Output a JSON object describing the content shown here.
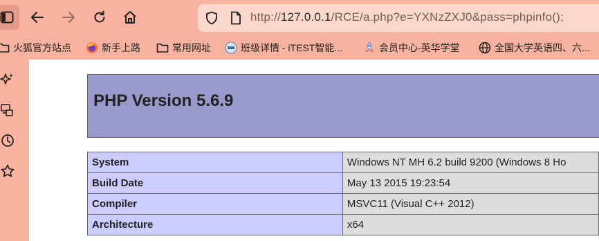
{
  "toolbar": {
    "url_prefix": "http://",
    "url_host": "127.0.0.1",
    "url_rest": "/RCE/a.php?e=YXNzZXJ0&pass=phpinfo();"
  },
  "bookmarks": [
    {
      "label": "火狐官方站点",
      "icon": "folder-icon"
    },
    {
      "label": "新手上路",
      "icon": "firefox-icon"
    },
    {
      "label": "常用网址",
      "icon": "folder-icon"
    },
    {
      "label": "班级详情 - iTEST智能...",
      "icon": "itest-icon"
    },
    {
      "label": "会员中心-英华学堂",
      "icon": "rocket-icon"
    },
    {
      "label": "全国大学英语四、六...",
      "icon": "globe-icon"
    }
  ],
  "page": {
    "title": "PHP Version 5.6.9",
    "rows": [
      {
        "key": "System",
        "value": "Windows NT MH 6.2 build 9200 (Windows 8 Ho"
      },
      {
        "key": "Build Date",
        "value": "May 13 2015 19:23:54"
      },
      {
        "key": "Compiler",
        "value": "MSVC11 (Visual C++ 2012)"
      },
      {
        "key": "Architecture",
        "value": "x64"
      }
    ]
  },
  "colors": {
    "chrome_bg": "#f7b3a0",
    "url_bg": "#fbd8cc",
    "php_header": "#9999cc",
    "php_key_cell": "#ccccff",
    "php_value_cell": "#dddddd"
  }
}
